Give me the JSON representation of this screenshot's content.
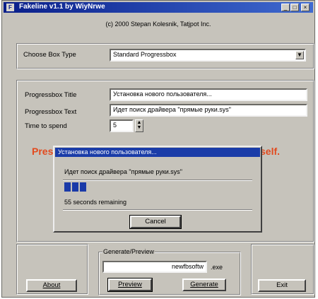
{
  "window": {
    "title": "Fakeline v1.1 by WiyNrwe",
    "app_icon": "app-icon",
    "controls": [
      "minimize-icon",
      "maximize-icon",
      "close-icon"
    ]
  },
  "copyright": "(c) 2000 Stepan Kolesnik, Tatjpot Inc.",
  "box_type": {
    "label": "Choose Box Type",
    "value": "Standard Progressbox"
  },
  "settings": {
    "title_label": "Progressbox Title",
    "title_value": "Установка нового пользователя...",
    "text_label": "Progressbox Text",
    "text_value": "Идет поиск драйвера \"прямые руки.sys\"",
    "time_label": "Time to spend",
    "time_value": "5"
  },
  "press_text_left": "Pres",
  "press_text_right": "self.",
  "dialog": {
    "title": "Установка нового пользователя...",
    "message": "Идет поиск драйвера \"прямые руки.sys\"",
    "progress_fraction": 0.12,
    "status": "55 seconds remaining",
    "cancel": "Cancel"
  },
  "bottom": {
    "about": "About",
    "group_label": "Generate/Preview",
    "filename": "newfbsoftw",
    "ext": ".exe",
    "preview": "Preview",
    "generate": "Generate",
    "exit": "Exit"
  }
}
